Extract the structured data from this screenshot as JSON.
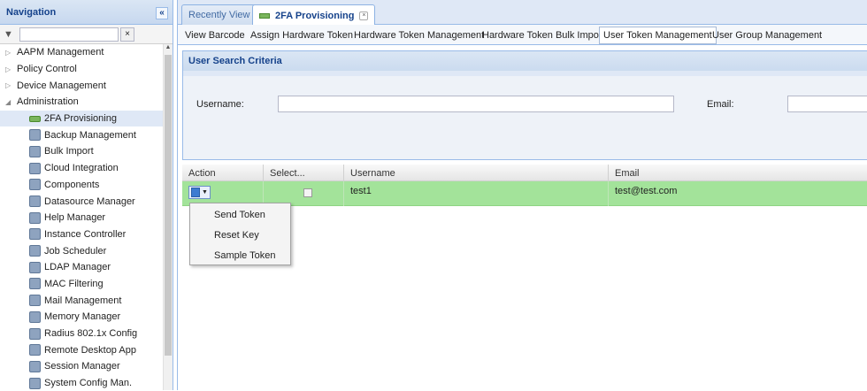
{
  "nav": {
    "title": "Navigation",
    "collapse_glyph": "«",
    "filter_clear_glyph": "×",
    "groups": [
      {
        "label": "AAPM Management",
        "expanded": false
      },
      {
        "label": "Policy Control",
        "expanded": false
      },
      {
        "label": "Device Management",
        "expanded": false
      },
      {
        "label": "Administration",
        "expanded": true
      }
    ],
    "items": [
      {
        "label": "2FA Provisioning",
        "selected": true,
        "icon": "token-icon"
      },
      {
        "label": "Backup Management",
        "icon": "backup-icon"
      },
      {
        "label": "Bulk Import",
        "icon": "import-icon"
      },
      {
        "label": "Cloud Integration",
        "icon": "cloud-icon"
      },
      {
        "label": "Components",
        "icon": "components-icon"
      },
      {
        "label": "Datasource Manager",
        "icon": "database-icon"
      },
      {
        "label": "Help Manager",
        "icon": "help-icon"
      },
      {
        "label": "Instance Controller",
        "icon": "instance-icon"
      },
      {
        "label": "Job Scheduler",
        "icon": "scheduler-icon"
      },
      {
        "label": "LDAP Manager",
        "icon": "ldap-icon"
      },
      {
        "label": "MAC Filtering",
        "icon": "mac-icon"
      },
      {
        "label": "Mail Management",
        "icon": "mail-icon"
      },
      {
        "label": "Memory Manager",
        "icon": "memory-icon"
      },
      {
        "label": "Radius 802.1x Config",
        "icon": "radius-icon"
      },
      {
        "label": "Remote Desktop App",
        "icon": "remote-desktop-icon"
      },
      {
        "label": "Session Manager",
        "icon": "session-icon"
      },
      {
        "label": "System Config Man.",
        "icon": "config-icon"
      }
    ]
  },
  "tabs": [
    {
      "label": "Recently View"
    },
    {
      "label": "2FA Provisioning",
      "active": true,
      "close_glyph": "×"
    }
  ],
  "subtabs": [
    "View Barcode",
    "Assign Hardware Token",
    "Hardware Token Management",
    "Hardware Token Bulk Import",
    "User Token Management",
    "User Group Management"
  ],
  "criteria": {
    "title": "User Search Criteria",
    "username_label": "Username:",
    "email_label": "Email:"
  },
  "grid": {
    "columns": [
      "Action",
      "Select...",
      "Username",
      "Email"
    ],
    "rows": [
      {
        "username": "test1",
        "email": "test@test.com"
      }
    ]
  },
  "action_menu": [
    "Send Token",
    "Reset Key",
    "Sample Token"
  ],
  "colors": {
    "selected_row": "#a3e39a",
    "header_text": "#15428b"
  }
}
